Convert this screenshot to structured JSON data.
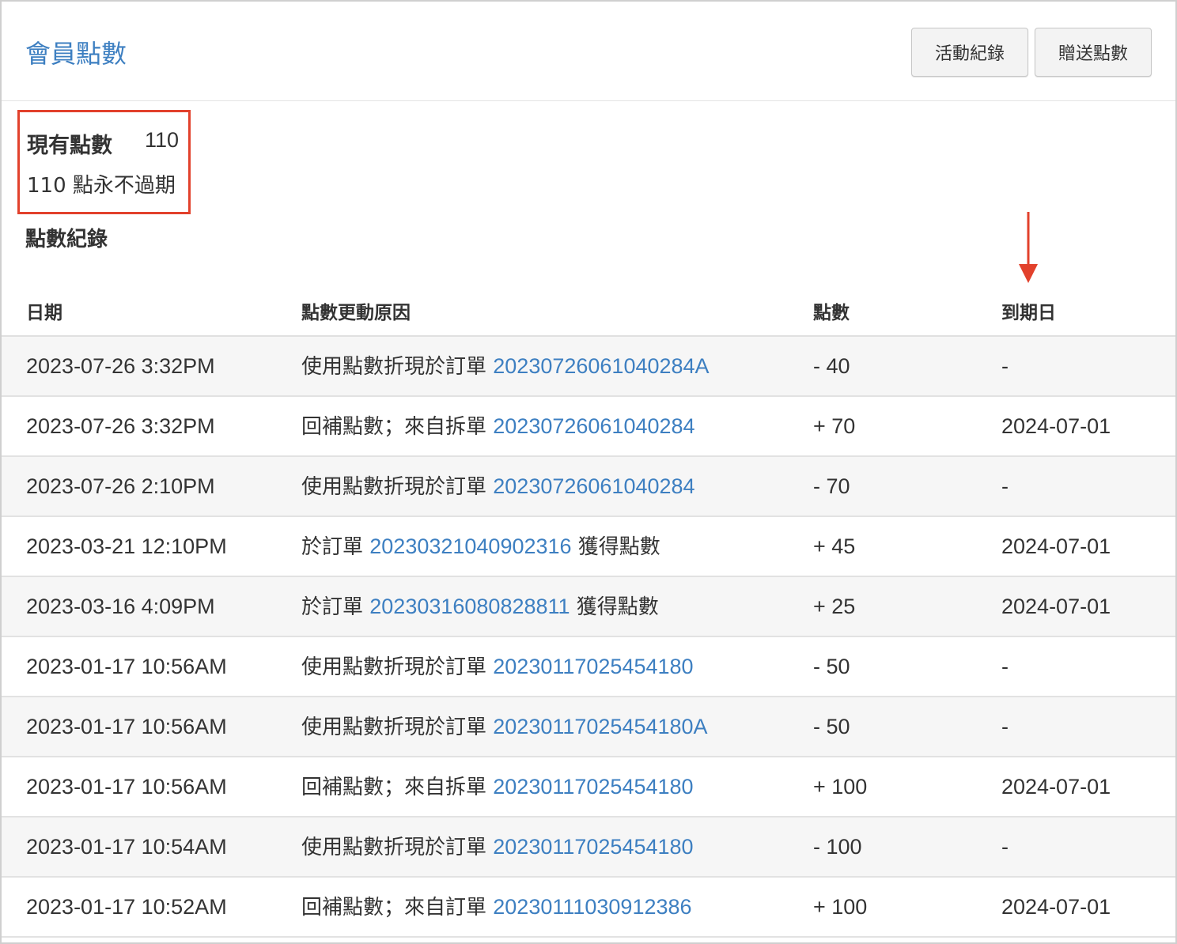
{
  "header": {
    "title": "會員點數",
    "buttons": {
      "activity_log": "活動紀錄",
      "gift_points": "贈送點數"
    }
  },
  "summary": {
    "current_points_label": "現有點數",
    "current_points_value": "110",
    "expiry_note": "110 點永不過期"
  },
  "history": {
    "title": "點數紀錄",
    "columns": {
      "date": "日期",
      "reason": "點數更動原因",
      "points": "點數",
      "expiry": "到期日"
    },
    "rows": [
      {
        "date": "2023-07-26 3:32PM",
        "reason_prefix": "使用點數折現於訂單 ",
        "order": "20230726061040284A",
        "reason_suffix": "",
        "points": "- 40",
        "expiry": "-"
      },
      {
        "date": "2023-07-26 3:32PM",
        "reason_prefix": "回補點數；來自拆單 ",
        "order": "20230726061040284",
        "reason_suffix": "",
        "points": "+ 70",
        "expiry": "2024-07-01"
      },
      {
        "date": "2023-07-26 2:10PM",
        "reason_prefix": "使用點數折現於訂單 ",
        "order": "20230726061040284",
        "reason_suffix": "",
        "points": "- 70",
        "expiry": "-"
      },
      {
        "date": "2023-03-21 12:10PM",
        "reason_prefix": "於訂單 ",
        "order": "20230321040902316",
        "reason_suffix": " 獲得點數",
        "points": "+ 45",
        "expiry": "2024-07-01"
      },
      {
        "date": "2023-03-16 4:09PM",
        "reason_prefix": "於訂單 ",
        "order": "20230316080828811",
        "reason_suffix": " 獲得點數",
        "points": "+ 25",
        "expiry": "2024-07-01"
      },
      {
        "date": "2023-01-17 10:56AM",
        "reason_prefix": "使用點數折現於訂單 ",
        "order": "20230117025454180",
        "reason_suffix": "",
        "points": "- 50",
        "expiry": "-"
      },
      {
        "date": "2023-01-17 10:56AM",
        "reason_prefix": "使用點數折現於訂單 ",
        "order": "20230117025454180A",
        "reason_suffix": "",
        "points": "- 50",
        "expiry": "-"
      },
      {
        "date": "2023-01-17 10:56AM",
        "reason_prefix": "回補點數；來自拆單 ",
        "order": "20230117025454180",
        "reason_suffix": "",
        "points": "+ 100",
        "expiry": "2024-07-01"
      },
      {
        "date": "2023-01-17 10:54AM",
        "reason_prefix": "使用點數折現於訂單 ",
        "order": "20230117025454180",
        "reason_suffix": "",
        "points": "- 100",
        "expiry": "-"
      },
      {
        "date": "2023-01-17 10:52AM",
        "reason_prefix": "回補點數；來自訂單 ",
        "order": "20230111030912386",
        "reason_suffix": "",
        "points": "+ 100",
        "expiry": "2024-07-01"
      }
    ]
  },
  "annotations": {
    "highlight_color": "#e2412c",
    "arrow_icon": "down-arrow-icon"
  },
  "colors": {
    "link": "#3d7fc1",
    "row_stripe": "#f6f6f6"
  }
}
